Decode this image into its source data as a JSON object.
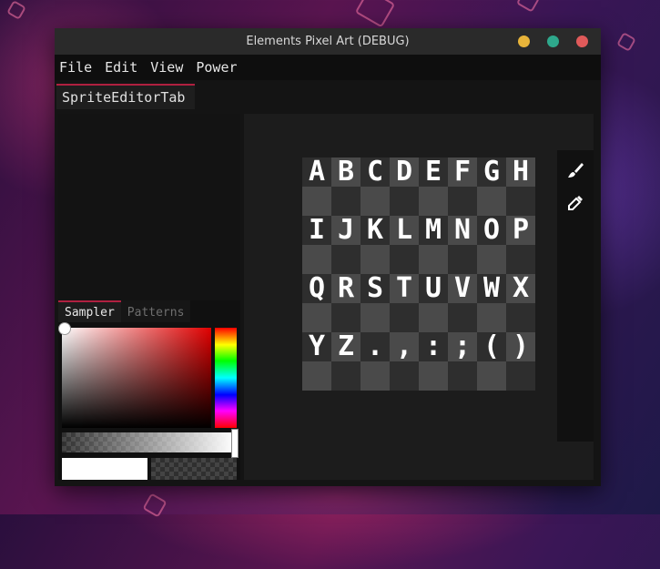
{
  "window": {
    "title": "Elements Pixel Art (DEBUG)",
    "controls": {
      "minimize_color": "#e8b43a",
      "maximize_color": "#2ea88c",
      "close_color": "#e05a5a"
    }
  },
  "menu": [
    "File",
    "Edit",
    "View",
    "Power"
  ],
  "tab": {
    "label": "SpriteEditorTab",
    "accent": "#b02040"
  },
  "sampler": {
    "tabs": [
      {
        "label": "Sampler",
        "active": true
      },
      {
        "label": "Patterns",
        "active": false
      }
    ],
    "selected_color": "#e00000",
    "primary_color": "#ffffff"
  },
  "sprite": {
    "rows": [
      [
        "A",
        "B",
        "C",
        "D",
        "E",
        "F",
        "G",
        "H"
      ],
      [
        "I",
        "J",
        "K",
        "L",
        "M",
        "N",
        "O",
        "P"
      ],
      [
        "Q",
        "R",
        "S",
        "T",
        "U",
        "V",
        "W",
        "X"
      ],
      [
        "Y",
        "Z",
        ".",
        ",",
        ":",
        ";",
        "(",
        ")"
      ]
    ],
    "checker_light": "#4a4a4a",
    "checker_dark": "#2e2e2e"
  },
  "tools": [
    "brush-icon",
    "eyedropper-icon"
  ]
}
